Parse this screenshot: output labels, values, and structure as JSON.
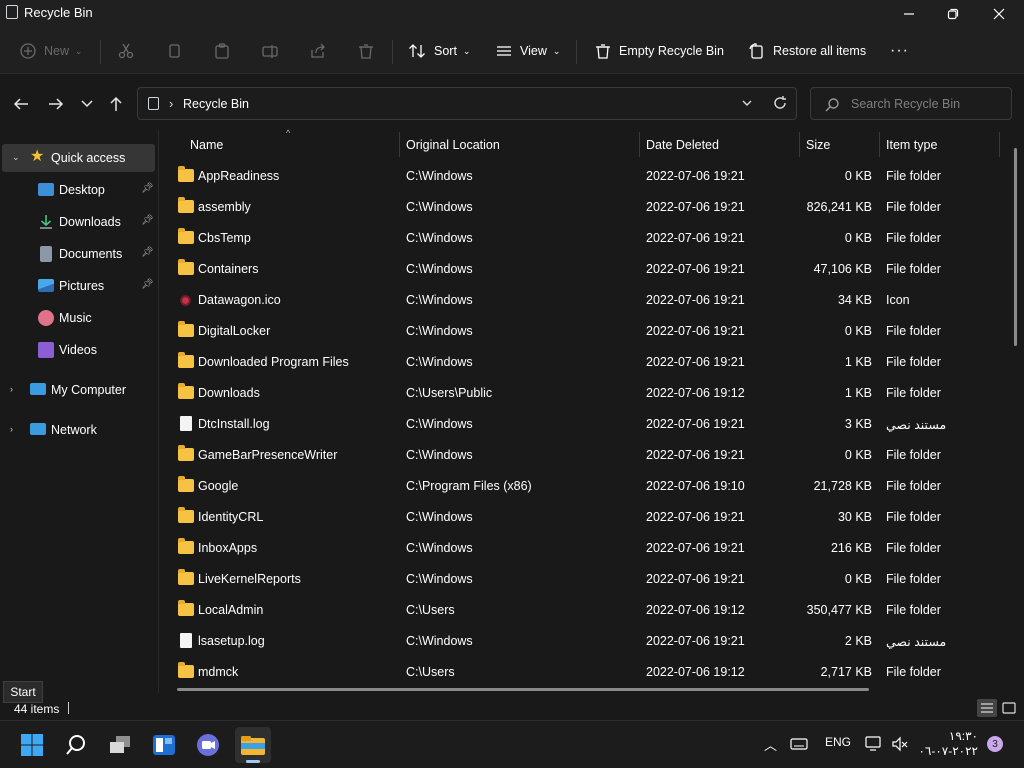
{
  "window": {
    "title": "Recycle Bin"
  },
  "toolbar": {
    "new_label": "New",
    "sort_label": "Sort",
    "view_label": "View",
    "empty_label": "Empty Recycle Bin",
    "restore_label": "Restore all items",
    "more_label": "···"
  },
  "address": {
    "path": "Recycle Bin",
    "search_placeholder": "Search Recycle Bin"
  },
  "sidebar": {
    "quick_access": "Quick access",
    "items": [
      {
        "label": "Desktop",
        "icon": "desktop-icon",
        "pinned": true
      },
      {
        "label": "Downloads",
        "icon": "download-icon",
        "pinned": true
      },
      {
        "label": "Documents",
        "icon": "documents-icon",
        "pinned": true
      },
      {
        "label": "Pictures",
        "icon": "pictures-icon",
        "pinned": true
      },
      {
        "label": "Music",
        "icon": "music-icon",
        "pinned": false
      },
      {
        "label": "Videos",
        "icon": "videos-icon",
        "pinned": false
      }
    ],
    "my_computer": "My Computer",
    "network": "Network"
  },
  "columns": {
    "name": "Name",
    "location": "Original Location",
    "date": "Date Deleted",
    "size": "Size",
    "type": "Item type"
  },
  "files": [
    {
      "name": "AppReadiness",
      "location": "C:\\Windows",
      "date": "2022-07-06 19:21",
      "size": "0 KB",
      "type": "File folder",
      "icon": "folder"
    },
    {
      "name": "assembly",
      "location": "C:\\Windows",
      "date": "2022-07-06 19:21",
      "size": "826,241 KB",
      "type": "File folder",
      "icon": "folder"
    },
    {
      "name": "CbsTemp",
      "location": "C:\\Windows",
      "date": "2022-07-06 19:21",
      "size": "0 KB",
      "type": "File folder",
      "icon": "folder"
    },
    {
      "name": "Containers",
      "location": "C:\\Windows",
      "date": "2022-07-06 19:21",
      "size": "47,106 KB",
      "type": "File folder",
      "icon": "folder"
    },
    {
      "name": "Datawagon.ico",
      "location": "C:\\Windows",
      "date": "2022-07-06 19:21",
      "size": "34 KB",
      "type": "Icon",
      "icon": "ico"
    },
    {
      "name": "DigitalLocker",
      "location": "C:\\Windows",
      "date": "2022-07-06 19:21",
      "size": "0 KB",
      "type": "File folder",
      "icon": "folder"
    },
    {
      "name": "Downloaded Program Files",
      "location": "C:\\Windows",
      "date": "2022-07-06 19:21",
      "size": "1 KB",
      "type": "File folder",
      "icon": "folder"
    },
    {
      "name": "Downloads",
      "location": "C:\\Users\\Public",
      "date": "2022-07-06 19:12",
      "size": "1 KB",
      "type": "File folder",
      "icon": "folder"
    },
    {
      "name": "DtcInstall.log",
      "location": "C:\\Windows",
      "date": "2022-07-06 19:21",
      "size": "3 KB",
      "type": "مستند نصي",
      "icon": "doc"
    },
    {
      "name": "GameBarPresenceWriter",
      "location": "C:\\Windows",
      "date": "2022-07-06 19:21",
      "size": "0 KB",
      "type": "File folder",
      "icon": "folder"
    },
    {
      "name": "Google",
      "location": "C:\\Program Files (x86)",
      "date": "2022-07-06 19:10",
      "size": "21,728 KB",
      "type": "File folder",
      "icon": "folder"
    },
    {
      "name": "IdentityCRL",
      "location": "C:\\Windows",
      "date": "2022-07-06 19:21",
      "size": "30 KB",
      "type": "File folder",
      "icon": "folder"
    },
    {
      "name": "InboxApps",
      "location": "C:\\Windows",
      "date": "2022-07-06 19:21",
      "size": "216 KB",
      "type": "File folder",
      "icon": "folder"
    },
    {
      "name": "LiveKernelReports",
      "location": "C:\\Windows",
      "date": "2022-07-06 19:21",
      "size": "0 KB",
      "type": "File folder",
      "icon": "folder"
    },
    {
      "name": "LocalAdmin",
      "location": "C:\\Users",
      "date": "2022-07-06 19:12",
      "size": "350,477 KB",
      "type": "File folder",
      "icon": "folder"
    },
    {
      "name": "lsasetup.log",
      "location": "C:\\Windows",
      "date": "2022-07-06 19:21",
      "size": "2 KB",
      "type": "مستند نصي",
      "icon": "doc"
    },
    {
      "name": "mdmck",
      "location": "C:\\Users",
      "date": "2022-07-06 19:12",
      "size": "2,717 KB",
      "type": "File folder",
      "icon": "folder"
    }
  ],
  "status": {
    "item_count": "44 items",
    "tooltip": "Start"
  },
  "taskbar": {
    "language": "ENG",
    "time": "١٩:٣٠",
    "date": "٢٠٢٢-٠٧-٠٦",
    "notifications": "3"
  }
}
